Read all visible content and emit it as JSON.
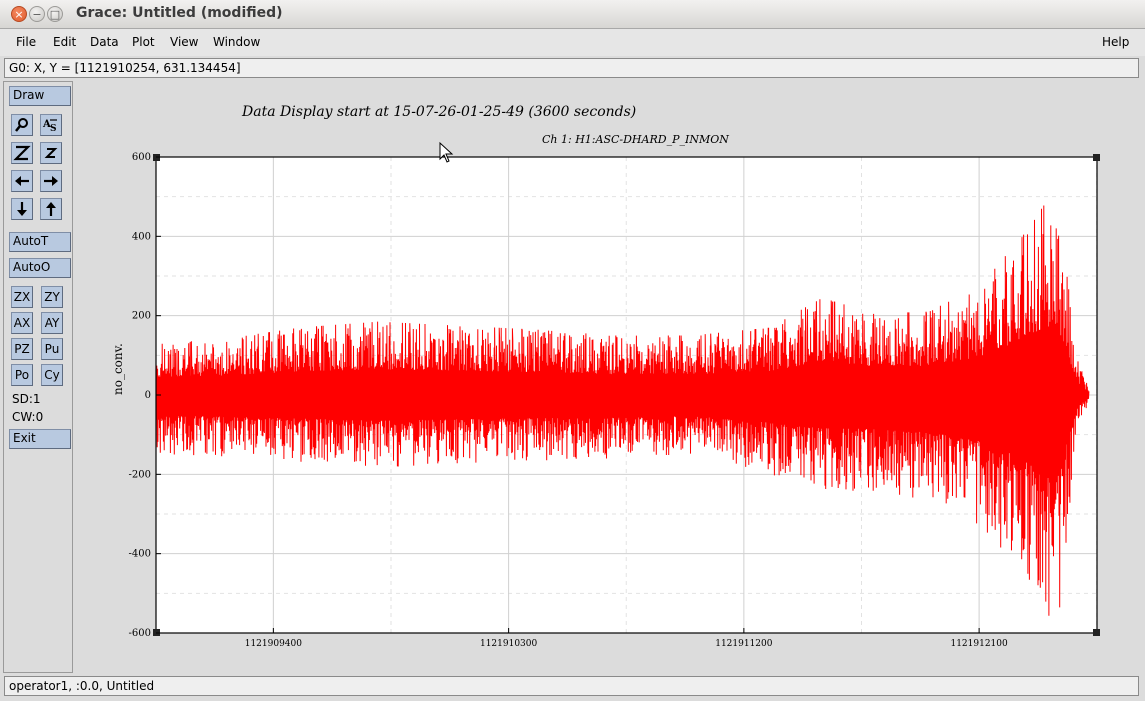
{
  "window": {
    "title": "Grace: Untitled (modified)",
    "close_glyph": "×",
    "min_glyph": "−",
    "max_glyph": "□"
  },
  "menu": {
    "file": "File",
    "edit": "Edit",
    "data": "Data",
    "plot": "Plot",
    "view": "View",
    "window": "Window",
    "help": "Help"
  },
  "coords_readout": "G0: X, Y = [1121910254, 631.134454]",
  "tools": {
    "draw": "Draw",
    "autot": "AutoT",
    "autoo": "AutoO",
    "zx": "ZX",
    "zy": "ZY",
    "ax": "AX",
    "ay": "AY",
    "pz": "PZ",
    "pu": "Pu",
    "po": "Po",
    "cy": "Cy",
    "sd": "SD:1",
    "cw": "CW:0",
    "exit": "Exit",
    "icons": [
      "zoom-icon",
      "autoscale-text-icon",
      "zoom-x-icon",
      "zoom-y-icon",
      "left-arrow-icon",
      "right-arrow-icon",
      "down-arrow-icon",
      "up-arrow-icon"
    ]
  },
  "plot": {
    "main_title": "Data Display start at 15-07-26-01-25-49 (3600 seconds)",
    "channel_title": "Ch 1: H1:ASC-DHARD_P_INMON"
  },
  "statusbar": "operator1, :0.0, Untitled",
  "chart_data": {
    "type": "line",
    "title": "Data Display start at 15-07-26-01-25-49 (3600 seconds)",
    "subtitle": "Ch 1: H1:ASC-DHARD_P_INMON",
    "xlabel": "",
    "ylabel": "no_conv.",
    "xlim": [
      1121908951,
      1121912551
    ],
    "ylim": [
      -600,
      600
    ],
    "x_ticks": [
      1121909400,
      1121910300,
      1121911200,
      1121912100
    ],
    "y_ticks": [
      -600,
      -400,
      -200,
      0,
      200,
      400,
      600
    ],
    "grid": true,
    "series": [
      {
        "color": "#ff0000",
        "envelope_x": [
          1121908951,
          1121909200,
          1121909500,
          1121909800,
          1121910100,
          1121910400,
          1121910700,
          1121911000,
          1121911300,
          1121911500,
          1121911700,
          1121911900,
          1121912100,
          1121912250,
          1121912350,
          1121912400,
          1121912440,
          1121912480,
          1121912520
        ],
        "envelope_max": [
          130,
          140,
          170,
          185,
          175,
          165,
          150,
          150,
          170,
          245,
          205,
          210,
          270,
          390,
          480,
          500,
          280,
          80,
          20
        ],
        "envelope_min": [
          -150,
          -155,
          -170,
          -185,
          -175,
          -165,
          -165,
          -150,
          -200,
          -240,
          -245,
          -265,
          -330,
          -440,
          -580,
          -600,
          -320,
          -80,
          -20
        ]
      }
    ]
  }
}
